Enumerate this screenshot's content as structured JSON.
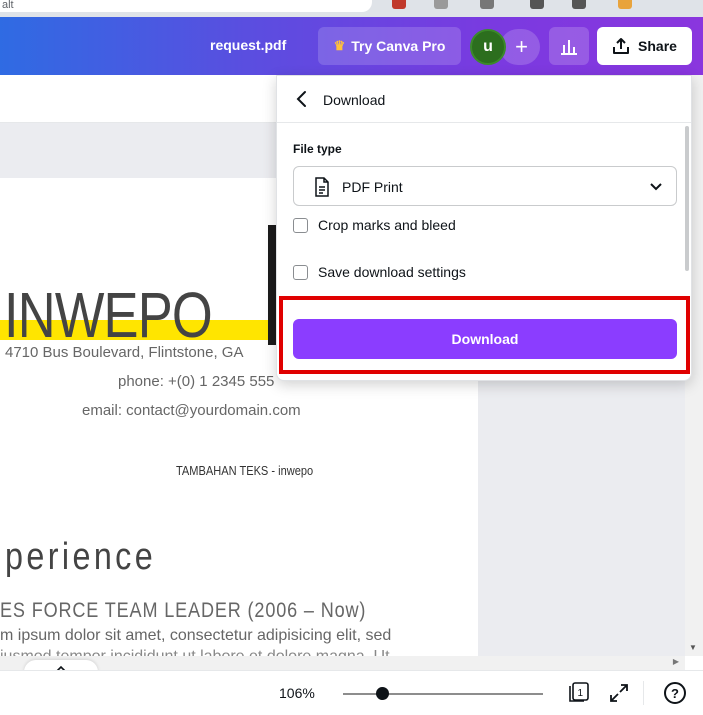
{
  "browser": {
    "address_fragment": "alt"
  },
  "header": {
    "document_title": "request.pdf",
    "try_pro_label": "Try Canva Pro",
    "avatar_initial": "u",
    "add_label": "+",
    "share_label": "Share",
    "gradient_start": "#2f6be3",
    "gradient_end": "#8a36de"
  },
  "canvas": {
    "name_text": "INWEPO",
    "address": "4710 Bus Boulevard, Flintstone, GA",
    "phone": "phone: +(0) 1 2345 555",
    "email": "email: contact@yourdomain.com",
    "extra_text": "TAMBAHAN TEKS - inwepo",
    "section_heading": "perience",
    "job_title": "ES FORCE TEAM LEADER (2006 – Now)",
    "lorem_line1": "m ipsum dolor sit amet, consectetur adipisicing elit, sed",
    "lorem_line2": "iusmod tempor incididunt ut labore et dolore magna. Ut",
    "accent_yellow": "#ffe500"
  },
  "download_panel": {
    "title": "Download",
    "file_type_label": "File type",
    "file_type_value": "PDF Print",
    "crop_marks_label": "Crop marks and bleed",
    "crop_marks_checked": false,
    "save_settings_label": "Save download settings",
    "save_settings_checked": false,
    "download_button_label": "Download",
    "button_color": "#8b3dff",
    "highlight_color": "#e00000"
  },
  "footer": {
    "zoom_label": "106%",
    "zoom_percent": 106,
    "page_count": "1",
    "help_label": "?",
    "scroll_tab_icon": "chevron-up-icon"
  }
}
